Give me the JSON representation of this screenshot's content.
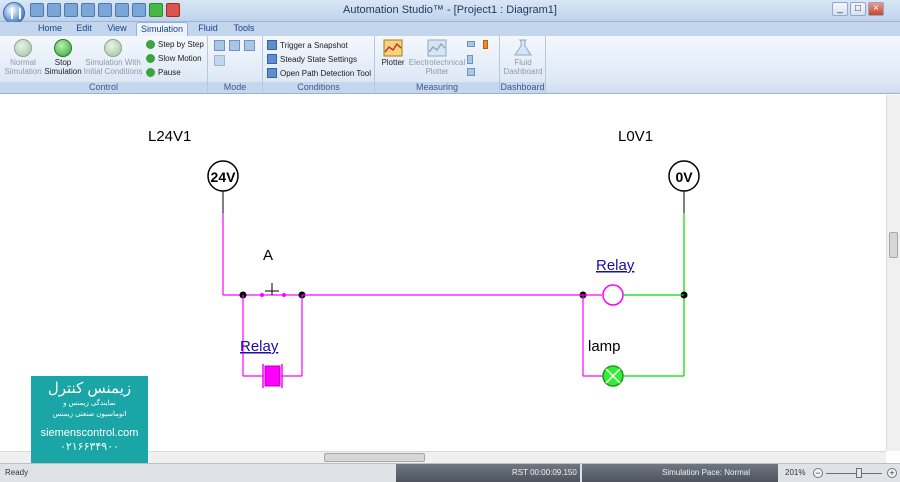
{
  "window": {
    "title": "Automation Studio™ - [Project1 : Diagram1]"
  },
  "tabs": [
    "Home",
    "Edit",
    "View",
    "Simulation",
    "Fluid",
    "Tools"
  ],
  "ribbon": {
    "control": {
      "label": "Control",
      "normal_sim": [
        "Normal",
        "Simulation"
      ],
      "stop_sim": [
        "Stop",
        "Simulation"
      ],
      "sim_initial": [
        "Simulation With",
        "Initial Conditions"
      ],
      "step_by_step": "Step by Step",
      "slow_motion": "Slow Motion",
      "pause": "Pause"
    },
    "mode": {
      "label": "Mode"
    },
    "conditions": {
      "label": "Conditions",
      "trigger": "Trigger a Snapshot",
      "steady": "Steady State Settings",
      "open_path": "Open Path Detection Tool"
    },
    "measuring": {
      "label": "Measuring",
      "plotter": "Plotter",
      "electro": [
        "Electrotechnical",
        "Plotter"
      ]
    },
    "dashboard": {
      "label": "Dashboard",
      "fluid": [
        "Fluid",
        "Dashboard"
      ]
    }
  },
  "diagram": {
    "l24_label": "L24V1",
    "l0_label": "L0V1",
    "v24": "24V",
    "v0": "0V",
    "switch_label": "A",
    "relay_top": "Relay",
    "relay_bottom": "Relay",
    "lamp_label": "lamp",
    "colors": {
      "energized": "#ff00ff",
      "ground": "#00dd00",
      "wire_black": "#000000"
    }
  },
  "status": {
    "ready": "Ready",
    "rst": "RST 00:00:09.150",
    "pace": "Simulation Pace: Normal",
    "zoom": "201%"
  },
  "watermark": {
    "title": "زیمنس کنترل",
    "sub1": "نمایندگی زیمنس و",
    "sub2": "اتوماسیون صنعتی زیمنس",
    "url": "siemenscontrol.com",
    "phone": "۰۲۱۶۶۳۴۹۰۰"
  }
}
